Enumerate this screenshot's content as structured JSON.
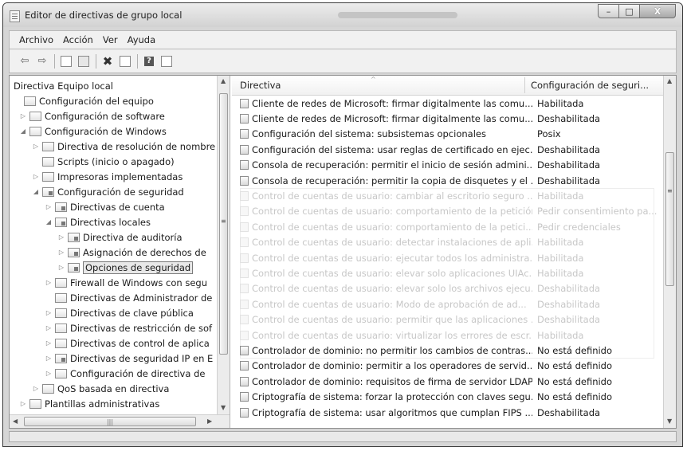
{
  "window": {
    "title": "Editor de directivas de grupo local",
    "controls": {
      "minimize": "–",
      "maximize": "□",
      "close": "X"
    }
  },
  "menu": [
    "Archivo",
    "Acción",
    "Ver",
    "Ayuda"
  ],
  "toolbar": [
    "back-icon",
    "forward-icon",
    "up-folder-icon",
    "show-tree-icon",
    "delete-icon",
    "properties-icon",
    "help-icon",
    "view-icon"
  ],
  "tree": {
    "items": [
      {
        "label": "Directiva Equipo local",
        "expander": "",
        "icon": ""
      },
      {
        "label": "Configuración del equipo",
        "expander": "",
        "icon": "computer-icon"
      },
      {
        "label": "Configuración de software",
        "expander": "▷",
        "icon": "folder-icon"
      },
      {
        "label": "Configuración de Windows",
        "expander": "◢",
        "icon": "folder-icon"
      },
      {
        "label": "Directiva de resolución de nombre",
        "expander": "▷",
        "icon": "folder-icon"
      },
      {
        "label": "Scripts (inicio o apagado)",
        "expander": "",
        "icon": "script-icon"
      },
      {
        "label": "Impresoras implementadas",
        "expander": "▷",
        "icon": "printer-icon"
      },
      {
        "label": "Configuración de seguridad",
        "expander": "◢",
        "icon": "security-icon"
      },
      {
        "label": "Directivas de cuenta",
        "expander": "▷",
        "icon": "security-folder-icon"
      },
      {
        "label": "Directivas locales",
        "expander": "◢",
        "icon": "security-folder-icon"
      },
      {
        "label": "Directiva de auditoría",
        "expander": "▷",
        "icon": "security-folder-icon"
      },
      {
        "label": "Asignación de derechos de",
        "expander": "▷",
        "icon": "security-folder-icon"
      },
      {
        "label": "Opciones de seguridad",
        "expander": "▷",
        "icon": "security-folder-icon"
      },
      {
        "label": "Firewall de Windows con segu",
        "expander": "▷",
        "icon": "folder-icon"
      },
      {
        "label": "Directivas de Administrador de",
        "expander": "",
        "icon": "folder-icon"
      },
      {
        "label": "Directivas de clave pública",
        "expander": "▷",
        "icon": "folder-icon"
      },
      {
        "label": "Directivas de restricción de sof",
        "expander": "▷",
        "icon": "folder-icon"
      },
      {
        "label": "Directivas de control de aplica",
        "expander": "▷",
        "icon": "folder-icon"
      },
      {
        "label": "Directivas de seguridad IP en E",
        "expander": "▷",
        "icon": "ip-security-icon"
      },
      {
        "label": "Configuración de directiva de",
        "expander": "▷",
        "icon": "folder-icon"
      },
      {
        "label": "QoS basada en directiva",
        "expander": "▷",
        "icon": "chart-icon"
      },
      {
        "label": "Plantillas administrativas",
        "expander": "▷",
        "icon": "folder-icon"
      }
    ],
    "selected": "Opciones de seguridad"
  },
  "list": {
    "columns": [
      "Directiva",
      "Configuración de seguri..."
    ],
    "rows": [
      {
        "policy": "Cliente de redes de Microsoft: firmar digitalmente las comu...",
        "setting": "Habilitada"
      },
      {
        "policy": "Cliente de redes de Microsoft: firmar digitalmente las comu...",
        "setting": "Deshabilitada"
      },
      {
        "policy": "Configuración del sistema: subsistemas opcionales",
        "setting": "Posix"
      },
      {
        "policy": "Configuración del sistema: usar reglas de certificado en ejec...",
        "setting": "Deshabilitada"
      },
      {
        "policy": "Consola de recuperación: permitir el inicio de sesión admini...",
        "setting": "Deshabilitada"
      },
      {
        "policy": "Consola de recuperación: permitir la copia de disquetes y el ...",
        "setting": "Deshabilitada"
      },
      {
        "policy": "Control de cuentas de usuario: cambiar al escritorio seguro ...",
        "setting": "Habilitada"
      },
      {
        "policy": "Control de cuentas de usuario: comportamiento de la petición...",
        "setting": "Pedir consentimiento pa..."
      },
      {
        "policy": "Control de cuentas de usuario: comportamiento de la petici...",
        "setting": "Pedir credenciales"
      },
      {
        "policy": "Control de cuentas de usuario: detectar instalaciones de apli...",
        "setting": "Habilitada"
      },
      {
        "policy": "Control de cuentas de usuario: ejecutar todos los administra...",
        "setting": "Habilitada"
      },
      {
        "policy": "Control de cuentas de usuario: elevar solo aplicaciones UIAc...",
        "setting": "Habilitada"
      },
      {
        "policy": "Control de cuentas de usuario: elevar solo los archivos ejecu...",
        "setting": "Deshabilitada"
      },
      {
        "policy": "Control de cuentas de usuario: Modo de aprobación de ad...",
        "setting": "Deshabilitada"
      },
      {
        "policy": "Control de cuentas de usuario: permitir que las aplicaciones ...",
        "setting": "Deshabilitada"
      },
      {
        "policy": "Control de cuentas de usuario: virtualizar los errores de escr...",
        "setting": "Habilitada"
      },
      {
        "policy": "Controlador de dominio: no permitir los cambios de contras...",
        "setting": "No está definido"
      },
      {
        "policy": "Controlador de dominio: permitir a los operadores de servid...",
        "setting": "No está definido"
      },
      {
        "policy": "Controlador de dominio: requisitos de firma de servidor LDAP",
        "setting": "No está definido"
      },
      {
        "policy": "Criptografía de sistema: forzar la protección con claves segu...",
        "setting": "No está definido"
      },
      {
        "policy": "Criptografía de sistema: usar algoritmos que cumplan FIPS ...",
        "setting": "Deshabilitada"
      }
    ]
  }
}
